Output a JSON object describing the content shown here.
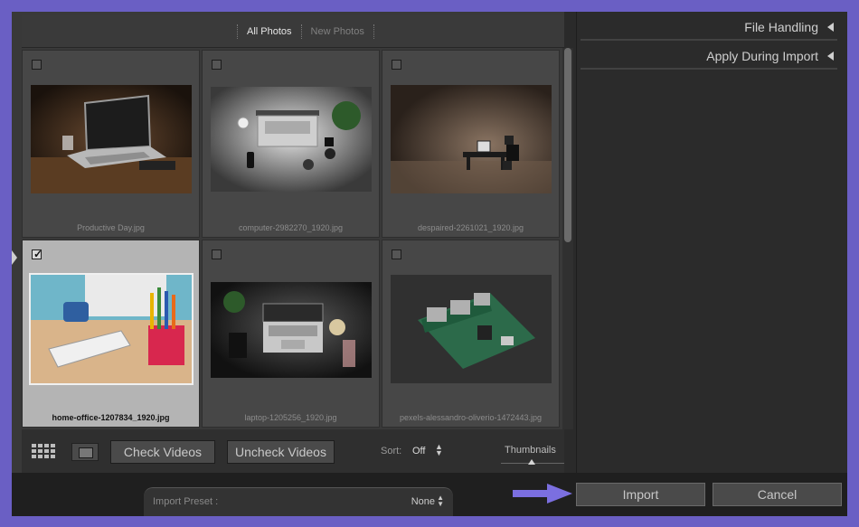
{
  "tabs": {
    "all_photos": "All Photos",
    "new_photos": "New Photos"
  },
  "photos": [
    {
      "filename": "Productive Day.jpg",
      "checked": false
    },
    {
      "filename": "computer-2982270_1920.jpg",
      "checked": false
    },
    {
      "filename": "despaired-2261021_1920.jpg",
      "checked": false
    },
    {
      "filename": "home-office-1207834_1920.jpg",
      "checked": true
    },
    {
      "filename": "laptop-1205256_1920.jpg",
      "checked": false
    },
    {
      "filename": "pexels-alessandro-oliverio-1472443.jpg",
      "checked": false
    }
  ],
  "toolbar": {
    "check_videos": "Check Videos",
    "uncheck_videos": "Uncheck Videos",
    "sort_label": "Sort:",
    "sort_value": "Off",
    "thumbnails_label": "Thumbnails"
  },
  "right_panel": {
    "file_handling": "File Handling",
    "apply_during_import": "Apply During Import"
  },
  "footer": {
    "preset_label": "Import Preset :",
    "preset_value": "None",
    "import": "Import",
    "cancel": "Cancel"
  },
  "colors": {
    "frame": "#6a5fc4",
    "arrow": "#7b6fe0",
    "selected_cell": "#b4b4b4"
  }
}
